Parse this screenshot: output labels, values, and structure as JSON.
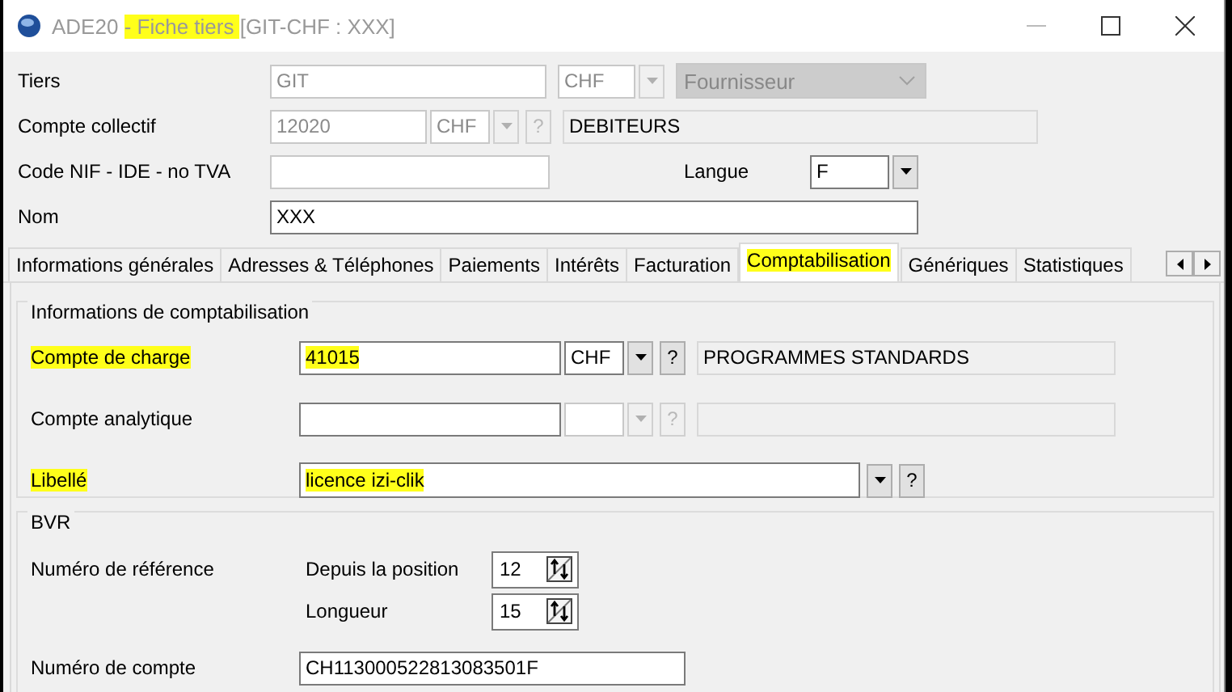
{
  "window": {
    "title_parts": [
      {
        "text": "ADE20 ",
        "highlighted": false
      },
      {
        "text": "- Fiche tiers ",
        "highlighted": true
      },
      {
        "text": "[GIT-CHF : XXX]",
        "highlighted": false
      }
    ]
  },
  "header": {
    "tiers": {
      "label": "Tiers",
      "code": "GIT",
      "currency": "CHF",
      "type": "Fournisseur",
      "disabled": true
    },
    "compte_collectif": {
      "label": "Compte collectif",
      "code": "12020",
      "currency": "CHF",
      "help": "?",
      "description": "DEBITEURS",
      "disabled": true
    },
    "nif": {
      "label": "Code NIF - IDE - no TVA"
    },
    "langue": {
      "label": "Langue",
      "value": "F"
    },
    "nom": {
      "label": "Nom",
      "value": "XXX"
    }
  },
  "tabs": [
    {
      "label": "Informations générales",
      "selected": false,
      "highlighted": false
    },
    {
      "label": "Adresses & Téléphones",
      "selected": false,
      "highlighted": false
    },
    {
      "label": "Paiements",
      "selected": false,
      "highlighted": false
    },
    {
      "label": "Intérêts",
      "selected": false,
      "highlighted": false
    },
    {
      "label": "Facturation",
      "selected": false,
      "highlighted": false
    },
    {
      "label": "Comptabilisation",
      "selected": true,
      "highlighted": true
    },
    {
      "label": "Génériques",
      "selected": false,
      "highlighted": false
    },
    {
      "label": "Statistiques",
      "selected": false,
      "highlighted": false
    }
  ],
  "accounting": {
    "title": "Informations de comptabilisation",
    "rows": [
      {
        "kind": "account",
        "label": "Compte de charge",
        "highlighted": true,
        "value": "41015",
        "currency": "CHF",
        "help": "?",
        "description": "PROGRAMMES STANDARDS",
        "disabled": false
      },
      {
        "kind": "account",
        "label": "Compte analytique",
        "highlighted": false,
        "help": "?",
        "disabled": true
      },
      {
        "kind": "text",
        "label": "Libellé",
        "highlighted": true,
        "value": "licence izi-clik",
        "help": "?",
        "disabled": false
      }
    ]
  },
  "bvr": {
    "title": "BVR",
    "reference": {
      "label": "Numéro de référence",
      "position": {
        "label": "Depuis la position",
        "value": "12"
      },
      "length": {
        "label": "Longueur",
        "value": "15"
      }
    },
    "account": {
      "label": "Numéro de compte",
      "value": "CH113000522813083501F"
    }
  }
}
